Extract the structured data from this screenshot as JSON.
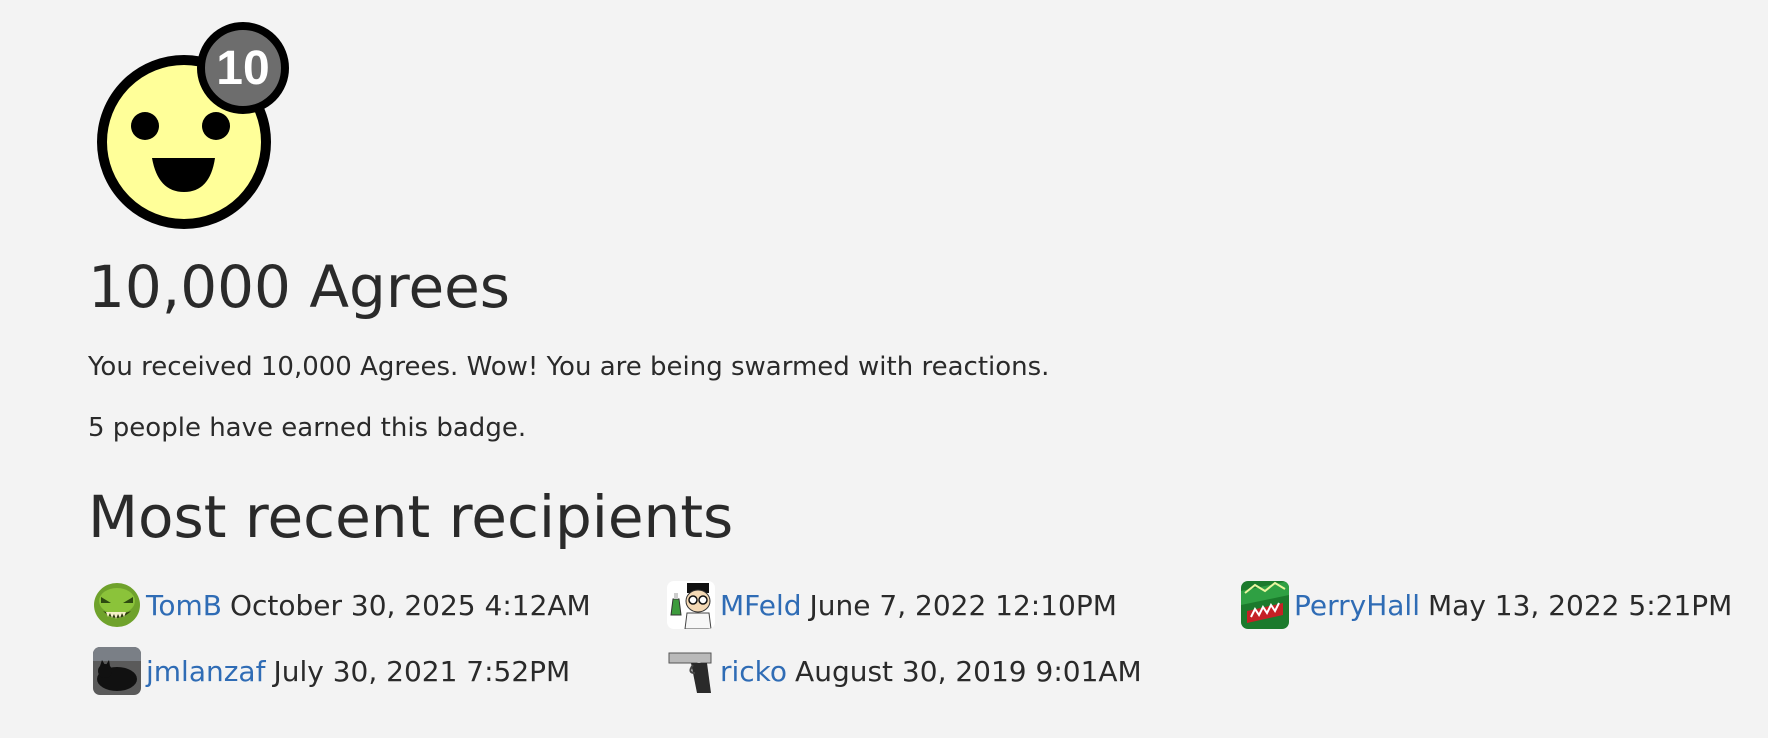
{
  "badge": {
    "icon": "smiley-face-icon",
    "level_label": "10",
    "title": "10,000 Agrees",
    "description": "You received 10,000 Agrees. Wow! You are being swarmed with reactions.",
    "earned_count_text": "5 people have earned this badge.",
    "colors": {
      "face_fill": "#ffff99",
      "outline": "#000000",
      "level_circle": "#6d6d6d",
      "level_text": "#ffffff"
    }
  },
  "recipients_section": {
    "title": "Most recent recipients",
    "items": [
      {
        "username": "TomB",
        "date": "October 30, 2025 4:12AM",
        "avatar_icon": "green-monster-avatar"
      },
      {
        "username": "MFeld",
        "date": "June 7, 2022 12:10PM",
        "avatar_icon": "scientist-cartoon-avatar"
      },
      {
        "username": "PerryHall",
        "date": "May 13, 2022 5:21PM",
        "avatar_icon": "mountain-dew-can-avatar"
      },
      {
        "username": "jmlanzaf",
        "date": "July 30, 2021 7:52PM",
        "avatar_icon": "black-cat-avatar"
      },
      {
        "username": "ricko",
        "date": "August 30, 2019 9:01AM",
        "avatar_icon": "pistol-avatar"
      }
    ]
  },
  "colors": {
    "background": "#f3f3f3",
    "text": "#2a2a2a",
    "link": "#2f6cb5"
  }
}
